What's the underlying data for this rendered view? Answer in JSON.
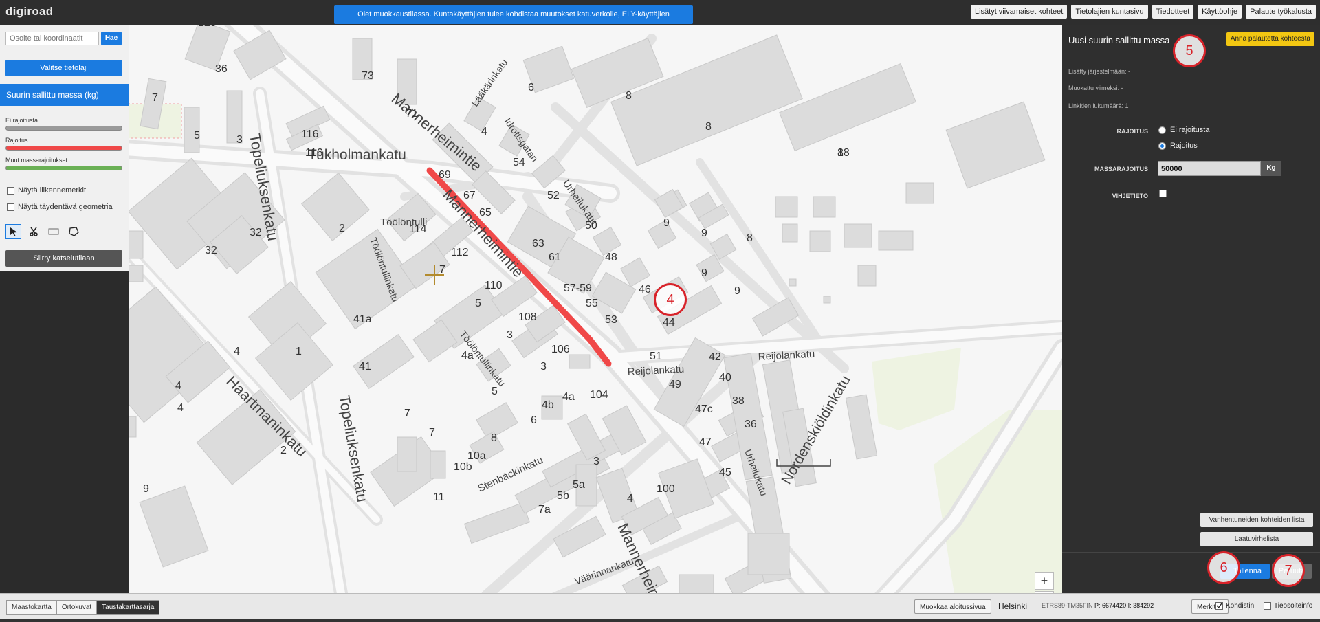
{
  "app": {
    "logo": "digiroad"
  },
  "notice": "Olet muokkaustilassa. Kuntakäyttäjien tulee kohdistaa muutokset katuverkolle, ELY-käyttäjien maantieverkolle.",
  "top_links": [
    "Lisätyt viivamaiset kohteet",
    "Tietolajien kuntasivu",
    "Tiedotteet",
    "Käyttöohje",
    "Palaute työkalusta"
  ],
  "left_panel": {
    "search_placeholder": "Osoite tai koordinaatit",
    "search_button": "Hae",
    "choose_layer_button": "Valitse tietolaji",
    "layer_title": "Suurin sallittu massa (kg)",
    "legend": [
      {
        "label": "Ei rajoitusta",
        "color": "#9a9a9a"
      },
      {
        "label": "Rajoitus",
        "color": "#f04848"
      },
      {
        "label": "Muut massarajoitukset",
        "color": "#6ab055"
      }
    ],
    "checkboxes": [
      "Näytä liikennemerkit",
      "Näytä täydentävä geometria"
    ],
    "tools": [
      "select-tool-icon",
      "cut-tool-icon",
      "rectangle-tool-icon",
      "polygon-tool-icon"
    ],
    "view_mode_button": "Siirry katselutilaan"
  },
  "map": {
    "street_names": [
      "Mannerheimintie",
      "Tukholmankatu",
      "Topeliuksenkatu",
      "Töölöntulli",
      "Töölöntullinkatu",
      "Haartmaninkatu",
      "Reijolankatu",
      "Stenbäckinkatu",
      "Urheilukatu",
      "Idrottsgatan",
      "Lääkärinkatu",
      "Nordenskiöldinkatu",
      "Väärinnankatu"
    ],
    "house_numbers": [
      "120",
      "36",
      "73",
      "71",
      "6",
      "8",
      "8",
      "18",
      "1",
      "3",
      "7",
      "5",
      "3",
      "116",
      "116",
      "4",
      "54",
      "52",
      "50",
      "69",
      "67",
      "65",
      "114",
      "2",
      "32",
      "32",
      "4",
      "112",
      "7",
      "63",
      "61",
      "57-59",
      "55",
      "53",
      "48",
      "46",
      "44",
      "9",
      "9",
      "8",
      "9",
      "9",
      "8",
      "110",
      "5",
      "108",
      "3",
      "106",
      "3",
      "41a",
      "41",
      "4",
      "1",
      "4",
      "4",
      "4",
      "4a",
      "5",
      "104",
      "4a",
      "4b",
      "6",
      "7",
      "7",
      "8",
      "10a",
      "10b",
      "3",
      "5a",
      "5b",
      "4",
      "100",
      "11",
      "2",
      "9",
      "7a",
      "51",
      "49",
      "47c",
      "47",
      "45",
      "42",
      "40",
      "38",
      "36",
      "4"
    ],
    "zoom_in": "+",
    "zoom_out": "−",
    "selected_segment_color": "#f04848"
  },
  "right_panel": {
    "title": "Uusi suurin sallittu massa",
    "feedback_button": "Anna palautetta kohteesta",
    "added": "Lisätty järjestelmään: -",
    "modified": "Muokattu viimeksi: -",
    "link_count": "Linkkien lukumäärä: 1",
    "restriction_label": "RAJOITUS",
    "radio_options": [
      "Ei rajoitusta",
      "Rajoitus"
    ],
    "radio_selected": "Rajoitus",
    "mass_label": "MASSARAJOITUS",
    "mass_value": "50000",
    "mass_unit": "Kg",
    "hint_label": "VIHJETIETO",
    "expired_list_button": "Vanhentuneiden kohteiden lista",
    "quality_errors_button": "Laatuvirhelista",
    "save_button": "Tallenna",
    "cancel_button": "Peruuta"
  },
  "annotations": [
    "4",
    "5",
    "6",
    "7"
  ],
  "bottom_bar": {
    "bg_tabs": [
      "Maastokartta",
      "Ortokuvat",
      "Taustakarttasarja"
    ],
    "bg_active": "Taustakarttasarja",
    "home_button": "Muokkaa aloitussivua",
    "city": "Helsinki",
    "crs": "ETRS89-TM35FIN",
    "p_coord": "P: 6674420",
    "i_coord": "I: 384292",
    "mark_button": "Merkitse",
    "centering": "Kohdistin",
    "road_info": "Tieosoiteinfo"
  }
}
